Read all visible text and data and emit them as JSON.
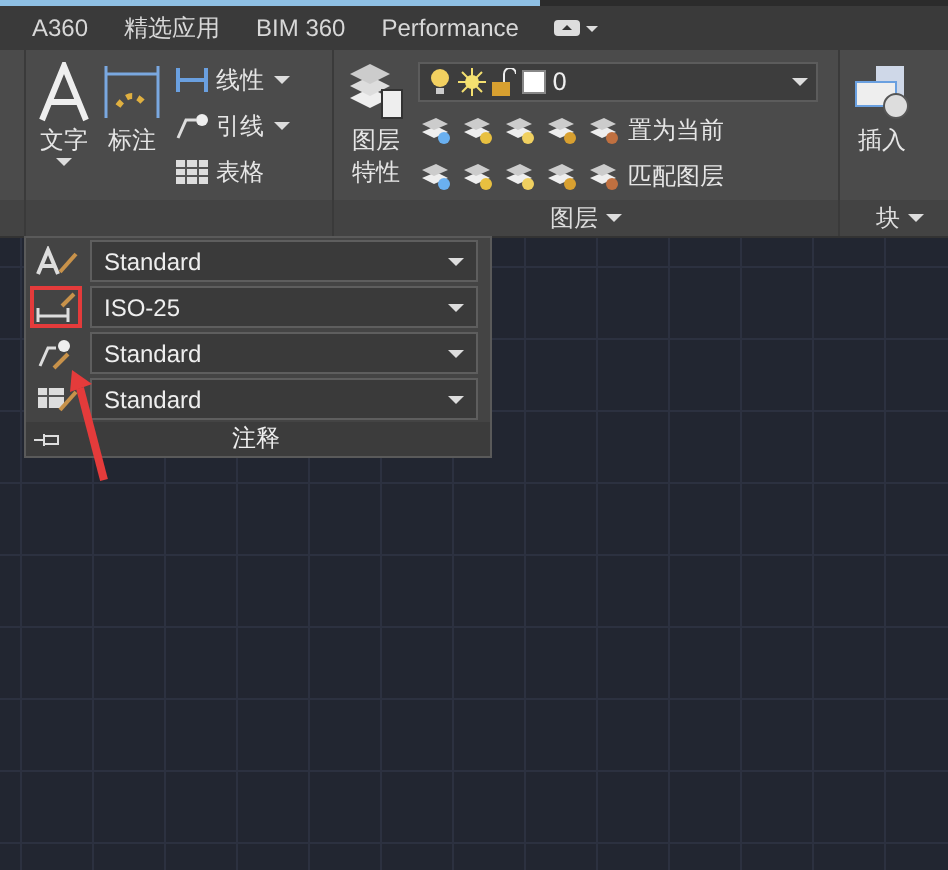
{
  "tabs": [
    {
      "label": "A360",
      "selected": false
    },
    {
      "label": "精选应用",
      "selected": false
    },
    {
      "label": "BIM 360",
      "selected": false
    },
    {
      "label": "Performance",
      "selected": false
    }
  ],
  "annotation_panel": {
    "text_tool": "文字",
    "dimension_tool": "标注",
    "small_tools": [
      {
        "kind": "linear",
        "label": "线性",
        "dropdown": true
      },
      {
        "kind": "leader",
        "label": "引线",
        "dropdown": true
      },
      {
        "kind": "table",
        "label": "表格",
        "dropdown": false
      }
    ]
  },
  "layers_panel": {
    "title": "图层",
    "properties_lines": [
      "图层",
      "特性"
    ],
    "current_layer": "0",
    "actions": [
      "置为当前",
      "匹配图层"
    ]
  },
  "block_panel": {
    "title": "块",
    "insert": "插入"
  },
  "annotation_flyout": {
    "title": "注释",
    "styles": [
      {
        "kind": "text",
        "value": "Standard",
        "highlighted": false
      },
      {
        "kind": "dimension",
        "value": "ISO-25",
        "highlighted": true
      },
      {
        "kind": "leader",
        "value": "Standard",
        "highlighted": false
      },
      {
        "kind": "table",
        "value": "Standard",
        "highlighted": false
      }
    ]
  }
}
